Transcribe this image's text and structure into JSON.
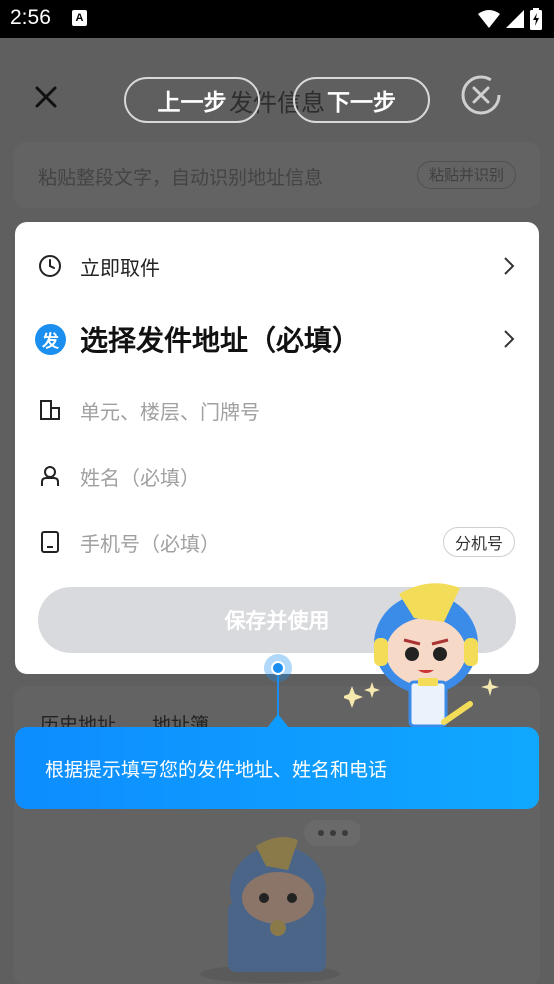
{
  "status_bar": {
    "time": "2:56",
    "a_badge": "A"
  },
  "header": {
    "title": "发件信息",
    "prev_step": "上一步",
    "next_step": "下一步"
  },
  "paste": {
    "placeholder": "粘贴整段文字，自动识别地址信息",
    "button": "粘贴并识别"
  },
  "card": {
    "pickup_label": "立即取件",
    "address_badge": "发",
    "address_label": "选择发件地址（必填）",
    "unit_placeholder": "单元、楼层、门牌号",
    "name_placeholder": "姓名（必填）",
    "phone_placeholder": "手机号（必填）",
    "extension_button": "分机号",
    "save_button": "保存并使用"
  },
  "history": {
    "tab_history": "历史地址",
    "tab_book": "地址簿"
  },
  "tooltip": {
    "text": "根据提示填写您的发件地址、姓名和电话"
  },
  "colors": {
    "accent": "#1a8ff0",
    "overlay": "#5f5f5f",
    "save_disabled": "#d9dadd"
  },
  "icons": [
    "clock-icon",
    "chevron-right-icon",
    "building-icon",
    "person-icon",
    "phone-icon",
    "close-icon",
    "skip-icon",
    "wifi-icon",
    "signal-icon",
    "battery-icon"
  ]
}
